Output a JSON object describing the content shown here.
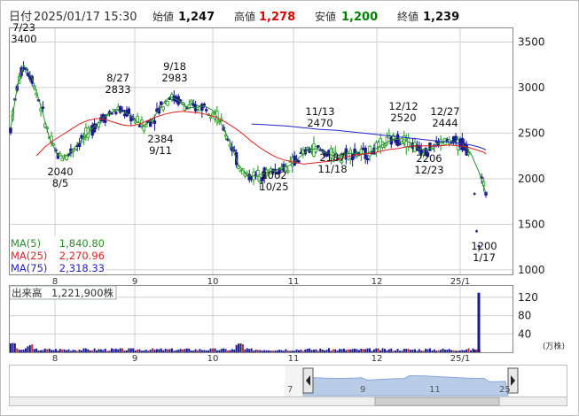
{
  "header": {
    "label_daily": "日付",
    "datetime": "2025/01/17 15:30",
    "open_label": "始値",
    "open_value": "1,247",
    "high_label": "高値",
    "high_value": "1,278",
    "low_label": "安値",
    "low_value": "1,200",
    "close_label": "終値",
    "close_value": "1,239"
  },
  "colors": {
    "up": "#1a9a1a",
    "down": "#1a1a8c",
    "ma5": "#2e8b2e",
    "ma25": "#e02020",
    "ma75": "#2323c8",
    "volume": "#1a1a8c",
    "volume_highlight": "#c82828",
    "high": "#e00000",
    "low": "#008000",
    "grid": "#d0d0d0",
    "navigator_fill": "#b8cce8"
  },
  "legend": {
    "ma5_label": "MA(5)",
    "ma5_value": "1,840.80",
    "ma25_label": "MA(25)",
    "ma25_value": "2,270.96",
    "ma75_label": "MA(75)",
    "ma75_value": "2,318.33"
  },
  "volume_panel": {
    "label": "出来高",
    "value": "1,221,900株",
    "unit": "(万株)",
    "ticks": [
      "120",
      "80",
      "40"
    ]
  },
  "navigator": {
    "labels": [
      "7",
      "9",
      "11",
      "25"
    ]
  },
  "chart_data": {
    "type": "candlestick",
    "x_ticks": [
      "8",
      "9",
      "10",
      "11",
      "12",
      "25/1"
    ],
    "y_ticks": [
      3500,
      3000,
      2500,
      2000,
      1500,
      1000
    ],
    "ylim": [
      950,
      3650
    ],
    "annotations": [
      {
        "date": "7/23",
        "value": "3400"
      },
      {
        "date": "8/5",
        "value": "2040"
      },
      {
        "date": "8/27",
        "value": "2833"
      },
      {
        "date": "9/11",
        "value": "2384"
      },
      {
        "date": "9/18",
        "value": "2983"
      },
      {
        "date": "10/25",
        "value": "2002"
      },
      {
        "date": "11/13",
        "value": "2470"
      },
      {
        "date": "11/18",
        "value": "2187"
      },
      {
        "date": "12/12",
        "value": "2520"
      },
      {
        "date": "12/23",
        "value": "2206"
      },
      {
        "date": "12/27",
        "value": "2444"
      },
      {
        "date": "1/17",
        "value": "1200"
      }
    ],
    "series": [
      {
        "name": "MA(5)",
        "values": [
          [
            0,
            2550
          ],
          [
            3,
            3000
          ],
          [
            6,
            3250
          ],
          [
            10,
            3100
          ],
          [
            14,
            2800
          ],
          [
            18,
            2450
          ],
          [
            22,
            2250
          ],
          [
            26,
            2250
          ],
          [
            30,
            2350
          ],
          [
            34,
            2450
          ],
          [
            38,
            2550
          ],
          [
            42,
            2650
          ],
          [
            46,
            2720
          ],
          [
            50,
            2750
          ],
          [
            54,
            2720
          ],
          [
            58,
            2640
          ],
          [
            62,
            2580
          ],
          [
            66,
            2650
          ],
          [
            70,
            2800
          ],
          [
            74,
            2900
          ],
          [
            78,
            2860
          ],
          [
            82,
            2780
          ],
          [
            86,
            2780
          ],
          [
            90,
            2800
          ],
          [
            94,
            2750
          ],
          [
            98,
            2600
          ],
          [
            102,
            2400
          ],
          [
            106,
            2150
          ],
          [
            110,
            2030
          ],
          [
            114,
            2030
          ],
          [
            118,
            2060
          ],
          [
            122,
            2090
          ],
          [
            126,
            2110
          ],
          [
            130,
            2150
          ],
          [
            134,
            2230
          ],
          [
            138,
            2310
          ],
          [
            142,
            2330
          ],
          [
            146,
            2290
          ],
          [
            150,
            2250
          ],
          [
            154,
            2260
          ],
          [
            158,
            2280
          ],
          [
            162,
            2270
          ],
          [
            166,
            2280
          ],
          [
            170,
            2330
          ],
          [
            174,
            2390
          ],
          [
            178,
            2430
          ],
          [
            182,
            2440
          ],
          [
            186,
            2390
          ],
          [
            190,
            2320
          ],
          [
            194,
            2320
          ],
          [
            198,
            2380
          ],
          [
            202,
            2410
          ],
          [
            206,
            2400
          ],
          [
            210,
            2380
          ],
          [
            214,
            2280
          ],
          [
            218,
            2060
          ],
          [
            221,
            1840
          ]
        ]
      },
      {
        "name": "MA(25)",
        "values": [
          [
            12,
            2250
          ],
          [
            16,
            2350
          ],
          [
            20,
            2420
          ],
          [
            24,
            2480
          ],
          [
            28,
            2540
          ],
          [
            32,
            2600
          ],
          [
            36,
            2640
          ],
          [
            40,
            2660
          ],
          [
            44,
            2650
          ],
          [
            48,
            2620
          ],
          [
            52,
            2590
          ],
          [
            56,
            2580
          ],
          [
            60,
            2600
          ],
          [
            64,
            2640
          ],
          [
            68,
            2680
          ],
          [
            72,
            2710
          ],
          [
            76,
            2730
          ],
          [
            80,
            2740
          ],
          [
            84,
            2730
          ],
          [
            88,
            2720
          ],
          [
            92,
            2700
          ],
          [
            96,
            2670
          ],
          [
            100,
            2620
          ],
          [
            104,
            2560
          ],
          [
            108,
            2490
          ],
          [
            112,
            2410
          ],
          [
            116,
            2340
          ],
          [
            120,
            2280
          ],
          [
            124,
            2230
          ],
          [
            128,
            2200
          ],
          [
            132,
            2180
          ],
          [
            136,
            2160
          ],
          [
            140,
            2170
          ],
          [
            144,
            2180
          ],
          [
            148,
            2190
          ],
          [
            152,
            2210
          ],
          [
            156,
            2240
          ],
          [
            160,
            2260
          ],
          [
            164,
            2270
          ],
          [
            168,
            2280
          ],
          [
            172,
            2300
          ],
          [
            176,
            2320
          ],
          [
            180,
            2330
          ],
          [
            184,
            2350
          ],
          [
            188,
            2360
          ],
          [
            192,
            2360
          ],
          [
            196,
            2360
          ],
          [
            200,
            2360
          ],
          [
            204,
            2370
          ],
          [
            208,
            2360
          ],
          [
            212,
            2350
          ],
          [
            216,
            2320
          ],
          [
            220,
            2290
          ],
          [
            221,
            2271
          ]
        ]
      },
      {
        "name": "MA(75)",
        "values": [
          [
            112,
            2600
          ],
          [
            120,
            2590
          ],
          [
            128,
            2580
          ],
          [
            136,
            2560
          ],
          [
            144,
            2540
          ],
          [
            152,
            2530
          ],
          [
            160,
            2510
          ],
          [
            168,
            2490
          ],
          [
            176,
            2470
          ],
          [
            184,
            2450
          ],
          [
            192,
            2430
          ],
          [
            200,
            2410
          ],
          [
            208,
            2390
          ],
          [
            214,
            2370
          ],
          [
            218,
            2345
          ],
          [
            221,
            2318
          ]
        ]
      }
    ],
    "volume_peak": 130,
    "volume_ylim": [
      0,
      145
    ]
  }
}
